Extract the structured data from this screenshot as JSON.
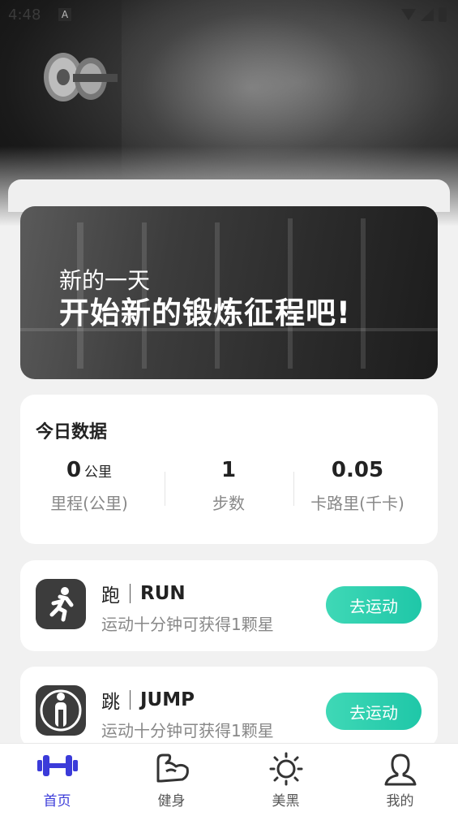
{
  "status_bar": {
    "time": "4:48",
    "notif": "A"
  },
  "banner": {
    "line1": "新的一天",
    "line2": "开始新的锻炼征程吧!"
  },
  "stats": {
    "title": "今日数据",
    "items": [
      {
        "value": "0",
        "unit": "公里",
        "label": "里程(公里)"
      },
      {
        "value": "1",
        "unit": "",
        "label": "步数"
      },
      {
        "value": "0.05",
        "unit": "",
        "label": "卡路里(千卡)"
      }
    ]
  },
  "activities": [
    {
      "zh": "跑",
      "en": "RUN",
      "desc": "运动十分钟可获得1颗星",
      "button": "去运动",
      "icon": "running-icon"
    },
    {
      "zh": "跳",
      "en": "JUMP",
      "desc": "运动十分钟可获得1颗星",
      "button": "去运动",
      "icon": "jump-rope-icon"
    }
  ],
  "nav": {
    "items": [
      {
        "label": "首页",
        "icon": "dumbbell-icon",
        "active": true
      },
      {
        "label": "健身",
        "icon": "arm-muscle-icon",
        "active": false
      },
      {
        "label": "美黑",
        "icon": "sun-icon",
        "active": false
      },
      {
        "label": "我的",
        "icon": "user-icon",
        "active": false
      }
    ]
  },
  "colors": {
    "accent": "#3b3bd9",
    "button": "#25cba9",
    "card": "#ffffff",
    "background": "#f1f1f1"
  }
}
